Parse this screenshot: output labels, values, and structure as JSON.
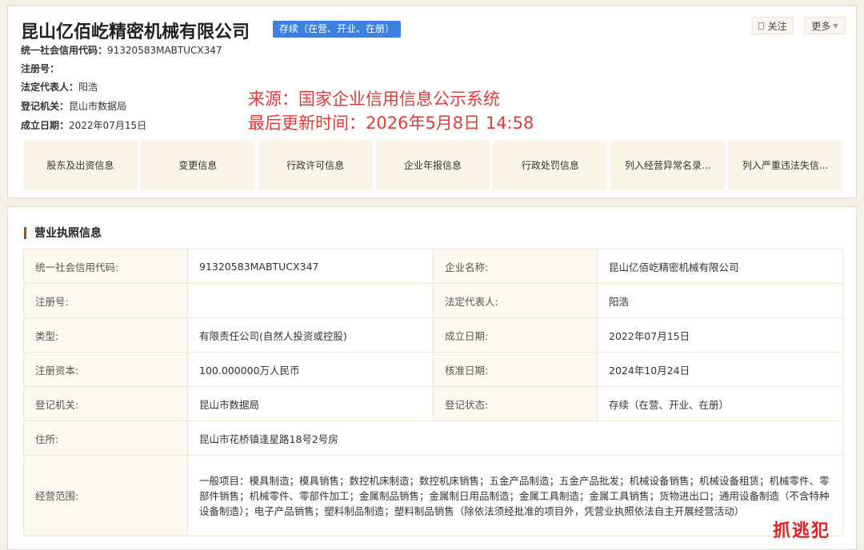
{
  "header": {
    "company_name": "昆山亿佰屹精密机械有限公司",
    "status_tag": "存续（在营、开业、在册）",
    "credit_code_label": "统一社会信用代码：",
    "credit_code": "91320583MABTUCX347",
    "reg_no_label": "注册号：",
    "reg_no": "",
    "legal_rep_label": "法定代表人：",
    "legal_rep": "阳浩",
    "authority_label": "登记机关：",
    "authority": "昆山市数据局",
    "established_label": "成立日期：",
    "established": "2022年07月15日",
    "follow_label": "关注",
    "more_label": "更多"
  },
  "watermark": {
    "source": "来源：国家企业信用信息公示系统",
    "updated": "最后更新时间：2026年5月8日 14:58"
  },
  "tabs": [
    {
      "label": "股东及出资信息"
    },
    {
      "label": "变更信息"
    },
    {
      "label": "行政许可信息"
    },
    {
      "label": "企业年报信息"
    },
    {
      "label": "行政处罚信息"
    },
    {
      "label": "列入经营异常名录..."
    },
    {
      "label": "列入严重违法失信..."
    }
  ],
  "license": {
    "section_title": "营业执照信息",
    "rows": [
      {
        "k1": "统一社会信用代码:",
        "v1": "91320583MABTUCX347",
        "k2": "企业名称:",
        "v2": "昆山亿佰屹精密机械有限公司"
      },
      {
        "k1": "注册号:",
        "v1": "",
        "k2": "法定代表人:",
        "v2": "阳浩"
      },
      {
        "k1": "类型:",
        "v1": "有限责任公司(自然人投资或控股)",
        "k2": "成立日期:",
        "v2": "2022年07月15日"
      },
      {
        "k1": "注册资本:",
        "v1": "100.000000万人民币",
        "k2": "核准日期:",
        "v2": "2024年10月24日"
      },
      {
        "k1": "登记机关:",
        "v1": "昆山市数据局",
        "k2": "登记状态:",
        "v2": "存续（在营、开业、在册）"
      }
    ],
    "address_label": "住所:",
    "address": "昆山市花桥镇逢星路18号2号房",
    "scope_label": "经营范围:",
    "scope": "一般项目：模具制造；模具销售；数控机床制造；数控机床销售；五金产品制造；五金产品批发；机械设备销售；机械设备租赁；机械零件、零部件销售；机械零件、零部件加工；金属制品销售；金属制日用品制造；金属工具制造；金属工具销售；货物进出口；通用设备制造（不含特种设备制造）；电子产品销售；塑料制品制造；塑料制品销售（除依法须经批准的项目外，凭营业执照依法自主开展经营活动）"
  },
  "corner_logo": "抓逃犯"
}
